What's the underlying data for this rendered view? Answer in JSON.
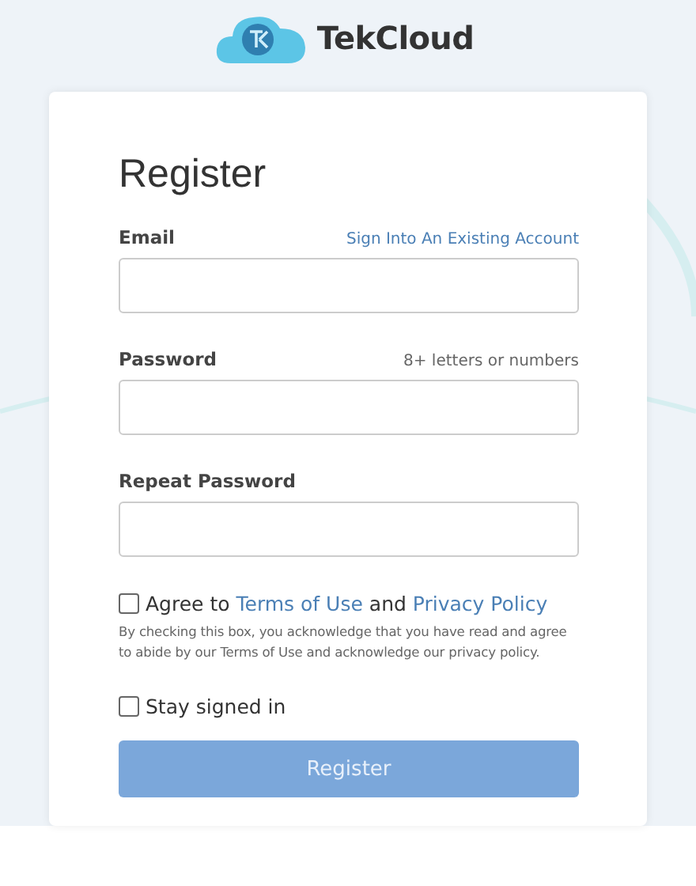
{
  "brand": {
    "name": "TekCloud"
  },
  "form": {
    "title": "Register",
    "signin_link": "Sign Into An Existing Account",
    "fields": [
      {
        "label": "Email"
      },
      {
        "label": "Password",
        "hint": "8+ letters or numbers"
      },
      {
        "label": "Repeat Password"
      }
    ],
    "agree": {
      "checked": false,
      "prefix": "Agree to",
      "terms": "Terms of Use",
      "joiner": "and",
      "privacy": "Privacy Policy"
    },
    "note": "By checking this box, you acknowledge that you have read and agree to abide by our Terms of Use and acknowledge our privacy policy.",
    "stay": {
      "label": "Stay signed in",
      "checked": false
    },
    "submit": {
      "label": "Register",
      "disabled": true
    }
  }
}
